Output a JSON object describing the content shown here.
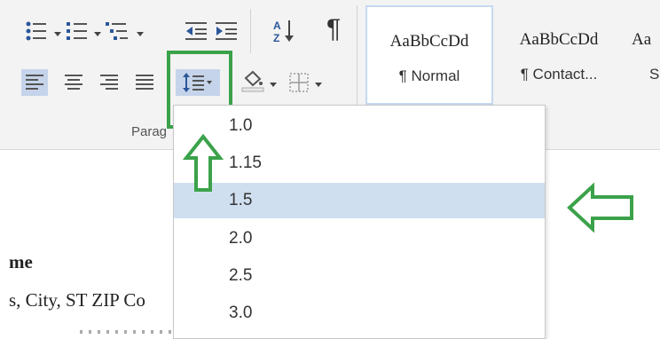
{
  "ribbon": {
    "paragraph_group_label": "Parag",
    "show_marks_glyph": "¶",
    "sort_glyph": "A↓Z"
  },
  "styles": [
    {
      "sample": "AaBbCcDd",
      "name": "¶ Normal",
      "selected": true
    },
    {
      "sample": "AaBbCcDd",
      "name": "¶ Contact...",
      "selected": false
    },
    {
      "sample": "Aa",
      "name": "S",
      "selected": false
    }
  ],
  "line_spacing_menu": {
    "options": [
      "1.0",
      "1.15",
      "1.5",
      "2.0",
      "2.5",
      "3.0"
    ],
    "highlighted": "1.5"
  },
  "document": {
    "line1": "me",
    "line2": "s, City, ST ZIP Co"
  },
  "colors": {
    "annotation_green": "#3ba24a",
    "menu_highlight": "#d0dff0",
    "ribbon_bg": "#f3f3f3",
    "icon_blue": "#2b579a"
  }
}
